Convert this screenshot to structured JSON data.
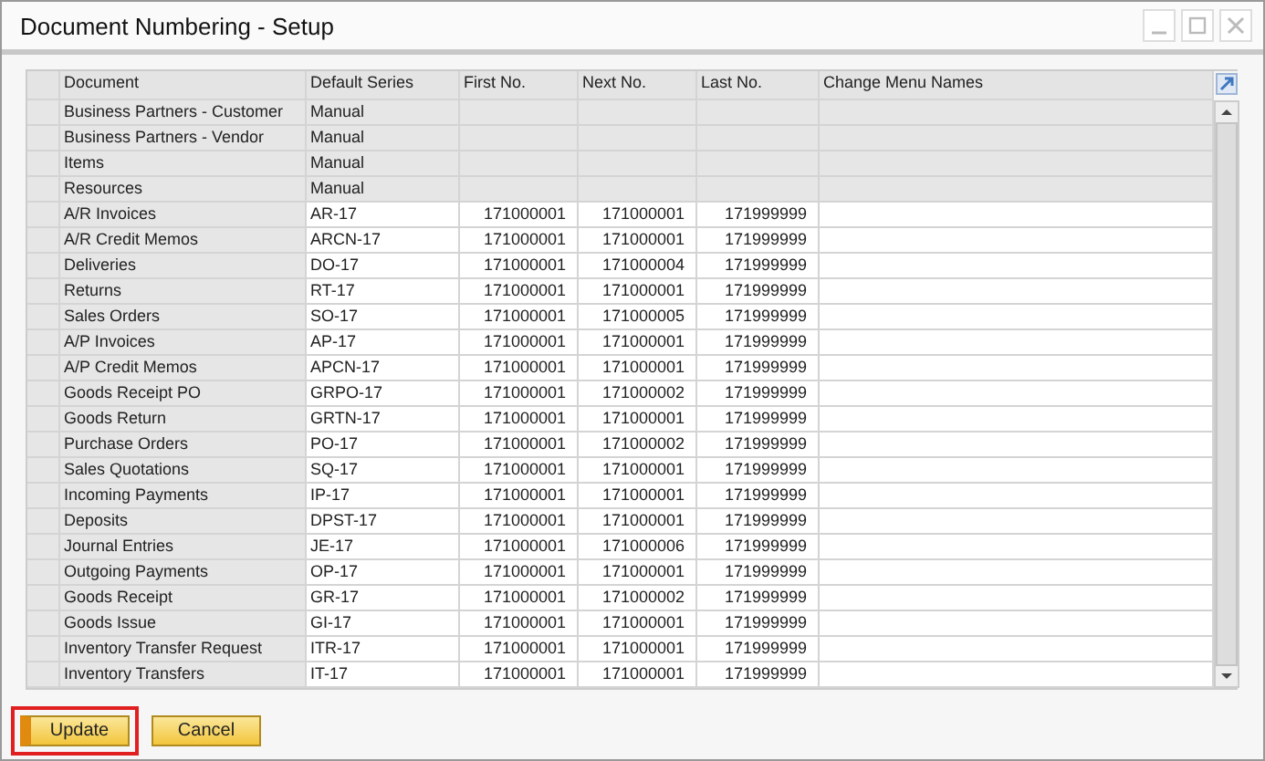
{
  "window": {
    "title": "Document Numbering - Setup"
  },
  "table": {
    "columns": [
      "Document",
      "Default Series",
      "First No.",
      "Next No.",
      "Last No.",
      "Change Menu Names"
    ],
    "rows": [
      {
        "editable": false,
        "cells": [
          "Business Partners - Customer",
          "Manual"
        ]
      },
      {
        "editable": false,
        "cells": [
          "Business Partners - Vendor",
          "Manual"
        ]
      },
      {
        "editable": false,
        "cells": [
          "Items",
          "Manual"
        ]
      },
      {
        "editable": false,
        "cells": [
          "Resources",
          "Manual"
        ]
      },
      {
        "editable": true,
        "cells": [
          "A/R Invoices",
          "AR-17",
          "171000001",
          "171000001",
          "171999999"
        ]
      },
      {
        "editable": true,
        "cells": [
          "A/R Credit Memos",
          "ARCN-17",
          "171000001",
          "171000001",
          "171999999"
        ]
      },
      {
        "editable": true,
        "cells": [
          "Deliveries",
          "DO-17",
          "171000001",
          "171000004",
          "171999999"
        ]
      },
      {
        "editable": true,
        "cells": [
          "Returns",
          "RT-17",
          "171000001",
          "171000001",
          "171999999"
        ]
      },
      {
        "editable": true,
        "cells": [
          "Sales Orders",
          "SO-17",
          "171000001",
          "171000005",
          "171999999"
        ]
      },
      {
        "editable": true,
        "cells": [
          "A/P Invoices",
          "AP-17",
          "171000001",
          "171000001",
          "171999999"
        ]
      },
      {
        "editable": true,
        "cells": [
          "A/P Credit Memos",
          "APCN-17",
          "171000001",
          "171000001",
          "171999999"
        ]
      },
      {
        "editable": true,
        "cells": [
          "Goods Receipt PO",
          "GRPO-17",
          "171000001",
          "171000002",
          "171999999"
        ]
      },
      {
        "editable": true,
        "cells": [
          "Goods Return",
          "GRTN-17",
          "171000001",
          "171000001",
          "171999999"
        ]
      },
      {
        "editable": true,
        "cells": [
          "Purchase Orders",
          "PO-17",
          "171000001",
          "171000002",
          "171999999"
        ]
      },
      {
        "editable": true,
        "cells": [
          "Sales Quotations",
          "SQ-17",
          "171000001",
          "171000001",
          "171999999"
        ]
      },
      {
        "editable": true,
        "cells": [
          "Incoming Payments",
          "IP-17",
          "171000001",
          "171000001",
          "171999999"
        ]
      },
      {
        "editable": true,
        "cells": [
          "Deposits",
          "DPST-17",
          "171000001",
          "171000001",
          "171999999"
        ]
      },
      {
        "editable": true,
        "cells": [
          "Journal Entries",
          "JE-17",
          "171000001",
          "171000006",
          "171999999"
        ]
      },
      {
        "editable": true,
        "cells": [
          "Outgoing Payments",
          "OP-17",
          "171000001",
          "171000001",
          "171999999"
        ]
      },
      {
        "editable": true,
        "cells": [
          "Goods Receipt",
          "GR-17",
          "171000001",
          "171000002",
          "171999999"
        ]
      },
      {
        "editable": true,
        "cells": [
          "Goods Issue",
          "GI-17",
          "171000001",
          "171000001",
          "171999999"
        ]
      },
      {
        "editable": true,
        "cells": [
          "Inventory Transfer Request",
          "ITR-17",
          "171000001",
          "171000001",
          "171999999"
        ]
      },
      {
        "editable": true,
        "cells": [
          "Inventory Transfers",
          "IT-17",
          "171000001",
          "171000001",
          "171999999"
        ]
      }
    ]
  },
  "buttons": [
    {
      "label": "Update",
      "highlighted": true
    },
    {
      "label": "Cancel",
      "highlighted": false
    }
  ]
}
